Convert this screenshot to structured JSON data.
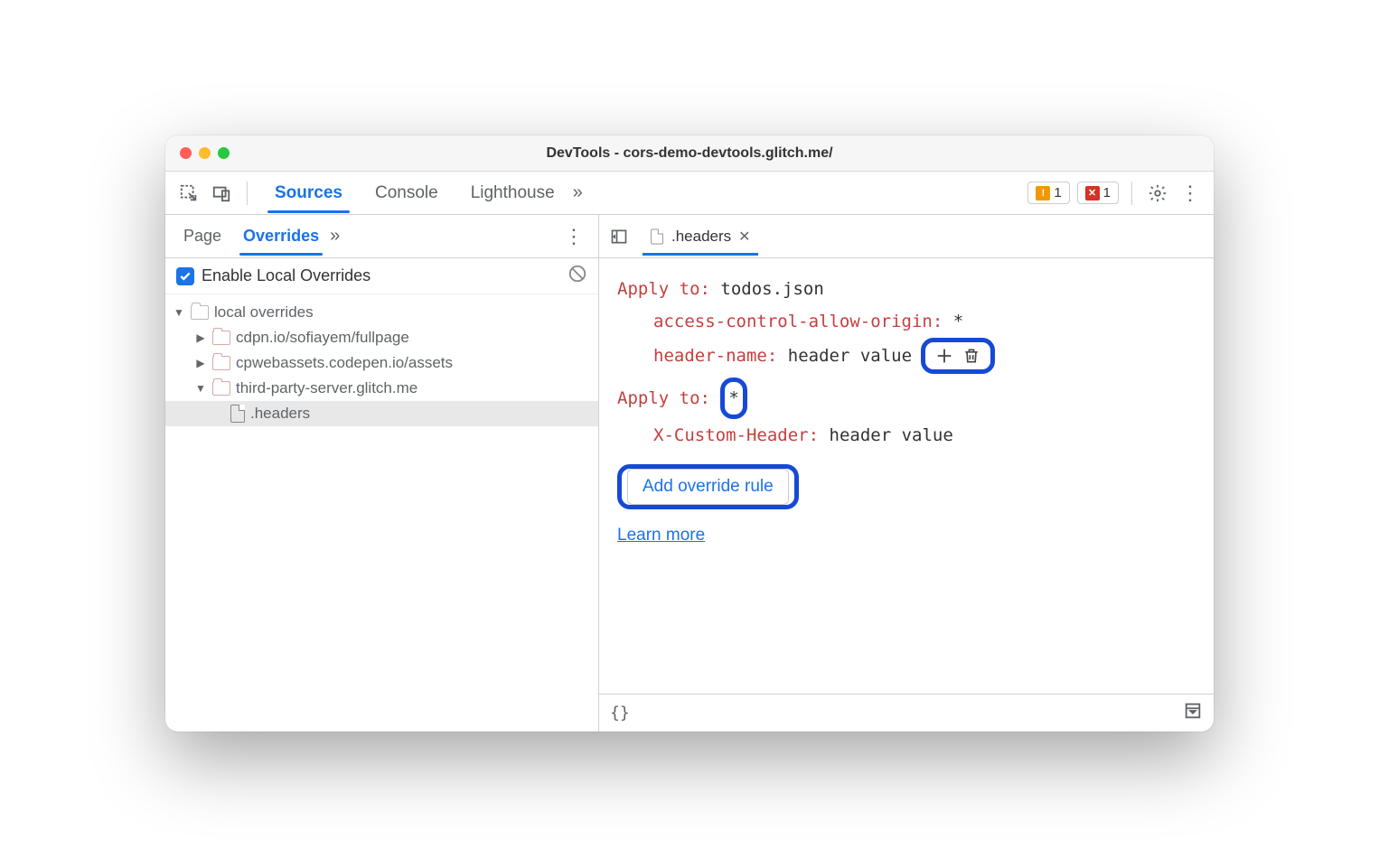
{
  "window": {
    "title": "DevTools - cors-demo-devtools.glitch.me/"
  },
  "toolbar": {
    "tabs": [
      "Sources",
      "Console",
      "Lighthouse"
    ],
    "active_tab": 0,
    "warning_count": "1",
    "error_count": "1"
  },
  "left_panel": {
    "tabs": [
      "Page",
      "Overrides"
    ],
    "active_tab": 1,
    "enable_label": "Enable Local Overrides",
    "tree": {
      "root": "local overrides",
      "folders": [
        "cdpn.io/sofiayem/fullpage",
        "cpwebassets.codepen.io/assets",
        "third-party-server.glitch.me"
      ],
      "selected_file": ".headers"
    }
  },
  "editor": {
    "tab_label": ".headers",
    "rules": [
      {
        "apply_to_label": "Apply to",
        "apply_to_value": "todos.json",
        "headers": [
          {
            "name": "access-control-allow-origin",
            "value": "*"
          },
          {
            "name": "header-name",
            "value": "header value"
          }
        ]
      },
      {
        "apply_to_label": "Apply to",
        "apply_to_value": "*",
        "headers": [
          {
            "name": "X-Custom-Header",
            "value": "header value"
          }
        ]
      }
    ],
    "add_rule_label": "Add override rule",
    "learn_more_label": "Learn more"
  },
  "bottombar": {
    "braces": "{}"
  }
}
